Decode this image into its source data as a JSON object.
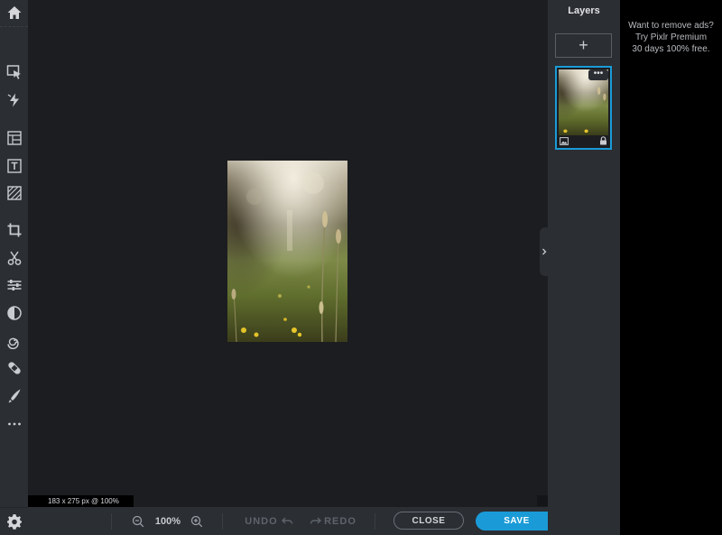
{
  "toolbar": {
    "items": [
      {
        "name": "home-icon"
      },
      {
        "name": "arrange-tool-icon"
      },
      {
        "name": "quick-select-icon"
      },
      {
        "name": "layout-tool-icon"
      },
      {
        "name": "text-tool-icon"
      },
      {
        "name": "pattern-tool-icon"
      },
      {
        "name": "crop-tool-icon"
      },
      {
        "name": "cutout-tool-icon"
      },
      {
        "name": "adjust-tool-icon"
      },
      {
        "name": "filter-tool-icon"
      },
      {
        "name": "liquify-tool-icon"
      },
      {
        "name": "heal-tool-icon"
      },
      {
        "name": "draw-tool-icon"
      },
      {
        "name": "more-tools-icon"
      },
      {
        "name": "settings-icon"
      }
    ]
  },
  "canvas": {
    "status": "183 x 275 px @ 100%"
  },
  "bottombar": {
    "zoom": "100%",
    "undo": "UNDO",
    "redo": "REDO",
    "close": "CLOSE",
    "save": "SAVE"
  },
  "layers": {
    "title": "Layers",
    "add": "+",
    "more": "•••"
  },
  "ad": {
    "lines": [
      "Want to remove ads?",
      "Try Pixlr Premium",
      "30 days 100% free."
    ]
  },
  "colors": {
    "accent": "#1a9bd7",
    "panel": "#2b2e33",
    "workspace": "#1c1d20"
  }
}
